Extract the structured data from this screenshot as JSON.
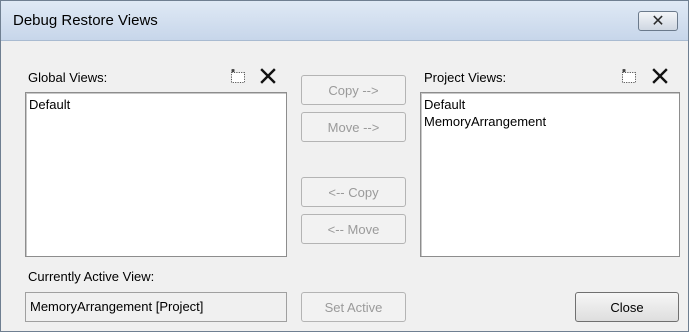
{
  "window": {
    "title": "Debug Restore Views",
    "close_glyph": "✕"
  },
  "global_views": {
    "label": "Global Views:",
    "items": [
      "Default"
    ]
  },
  "project_views": {
    "label": "Project Views:",
    "items": [
      "Default",
      "MemoryArrangement"
    ]
  },
  "actions": {
    "copy_right": "Copy -->",
    "move_right": "Move -->",
    "copy_left": "<-- Copy",
    "move_left": "<-- Move",
    "set_active": "Set Active",
    "close": "Close"
  },
  "active_view": {
    "label": "Currently Active View:",
    "value": "MemoryArrangement [Project]"
  },
  "icons": {
    "new_view": "new-view-icon",
    "delete_view": "delete-icon"
  }
}
